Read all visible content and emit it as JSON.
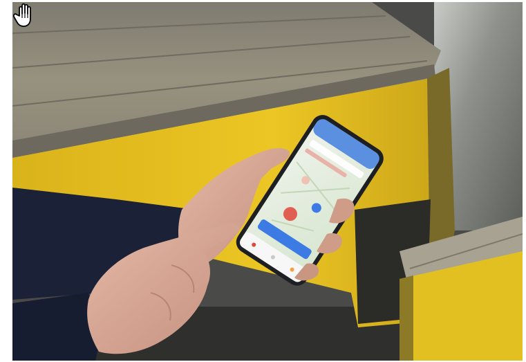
{
  "image": {
    "subject": "photograph",
    "cursor_icon": "hand-cursor-icon",
    "phone_screen_icon": "map-app-icon"
  },
  "colors": {
    "bench_wood": "#8d887b",
    "bench_yellow": "#e8c320",
    "background_dark": "#3e3f3c",
    "sleeve_navy": "#1b2237",
    "skin": "#d9a894",
    "phone_frame": "#1d1f22",
    "app_header_blue": "#5b8fe0",
    "app_button_blue": "#3b7be3",
    "map_green": "#cfe3c4",
    "map_hotspot_red": "#e0473a"
  }
}
